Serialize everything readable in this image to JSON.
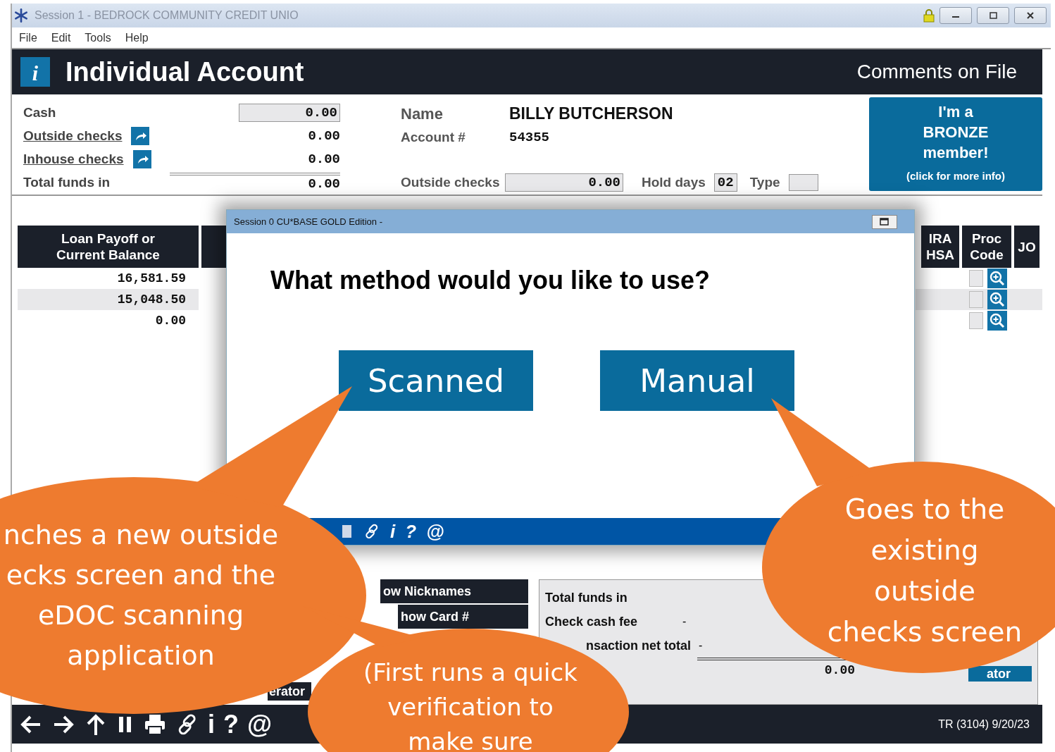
{
  "window": {
    "title": "Session 1  - BEDROCK COMMUNITY CREDIT UNIO"
  },
  "menu": [
    "File",
    "Edit",
    "Tools",
    "Help"
  ],
  "header": {
    "icon": "i",
    "title": "Individual Account",
    "comments": "Comments on File"
  },
  "funds": [
    {
      "label": "Cash",
      "value": "0.00",
      "kind": "field"
    },
    {
      "label": "Outside checks",
      "value": "0.00",
      "kind": "link"
    },
    {
      "label": "Inhouse checks",
      "value": "0.00",
      "kind": "link"
    },
    {
      "label": "Total funds in",
      "value": "0.00",
      "kind": "total"
    }
  ],
  "member": {
    "name_label": "Name",
    "name": "BILLY BUTCHERSON",
    "account_label": "Account #",
    "account": "54355",
    "outside_checks_label": "Outside checks",
    "outside_checks": "0.00",
    "hold_days_label": "Hold days",
    "hold_days": "02",
    "type_label": "Type"
  },
  "member_button": {
    "lines": [
      "I'm a",
      "BRONZE",
      "member!"
    ],
    "note": "(click for more info)"
  },
  "table": {
    "left_header": [
      "Loan Payoff or",
      "Current Balance"
    ],
    "right_headers": [
      [
        "IRA",
        "HSA"
      ],
      [
        "Proc",
        "Code"
      ],
      [
        "JO"
      ]
    ],
    "rows": [
      {
        "balance": "16,581.59",
        "shaded": false,
        "checked": false
      },
      {
        "balance": "15,048.50",
        "shaded": true,
        "checked": false
      },
      {
        "balance": "0.00",
        "shaded": false,
        "checked": false
      }
    ]
  },
  "dialog": {
    "title": "Session 0 CU*BASE GOLD Edition -",
    "question": "What method would you like to use?",
    "buttons": [
      "Scanned",
      "Manual"
    ],
    "toolbar": [
      "i",
      "?",
      "@"
    ]
  },
  "lower": {
    "nav": [
      "ow Nicknames",
      "how Card #",
      "erator"
    ],
    "totals": [
      {
        "label": "Total funds in"
      },
      {
        "label": "Check cash fee",
        "dash": "-"
      },
      {
        "label": "nsaction net total",
        "dash": "-"
      }
    ],
    "net": "0.00",
    "button": "ator"
  },
  "status_bar": {
    "toolbar": [
      "i",
      "?",
      "@"
    ],
    "text": "TR (3104) 9/20/23"
  },
  "callouts": [
    {
      "lines": [
        "nches a new outside",
        "ecks screen and the",
        "eDOC scanning",
        "application"
      ]
    },
    {
      "lines": [
        "(First runs a quick",
        "verification to",
        "make sure"
      ]
    },
    {
      "lines": [
        "Goes to the",
        "existing",
        "outside",
        "checks screen"
      ]
    }
  ]
}
